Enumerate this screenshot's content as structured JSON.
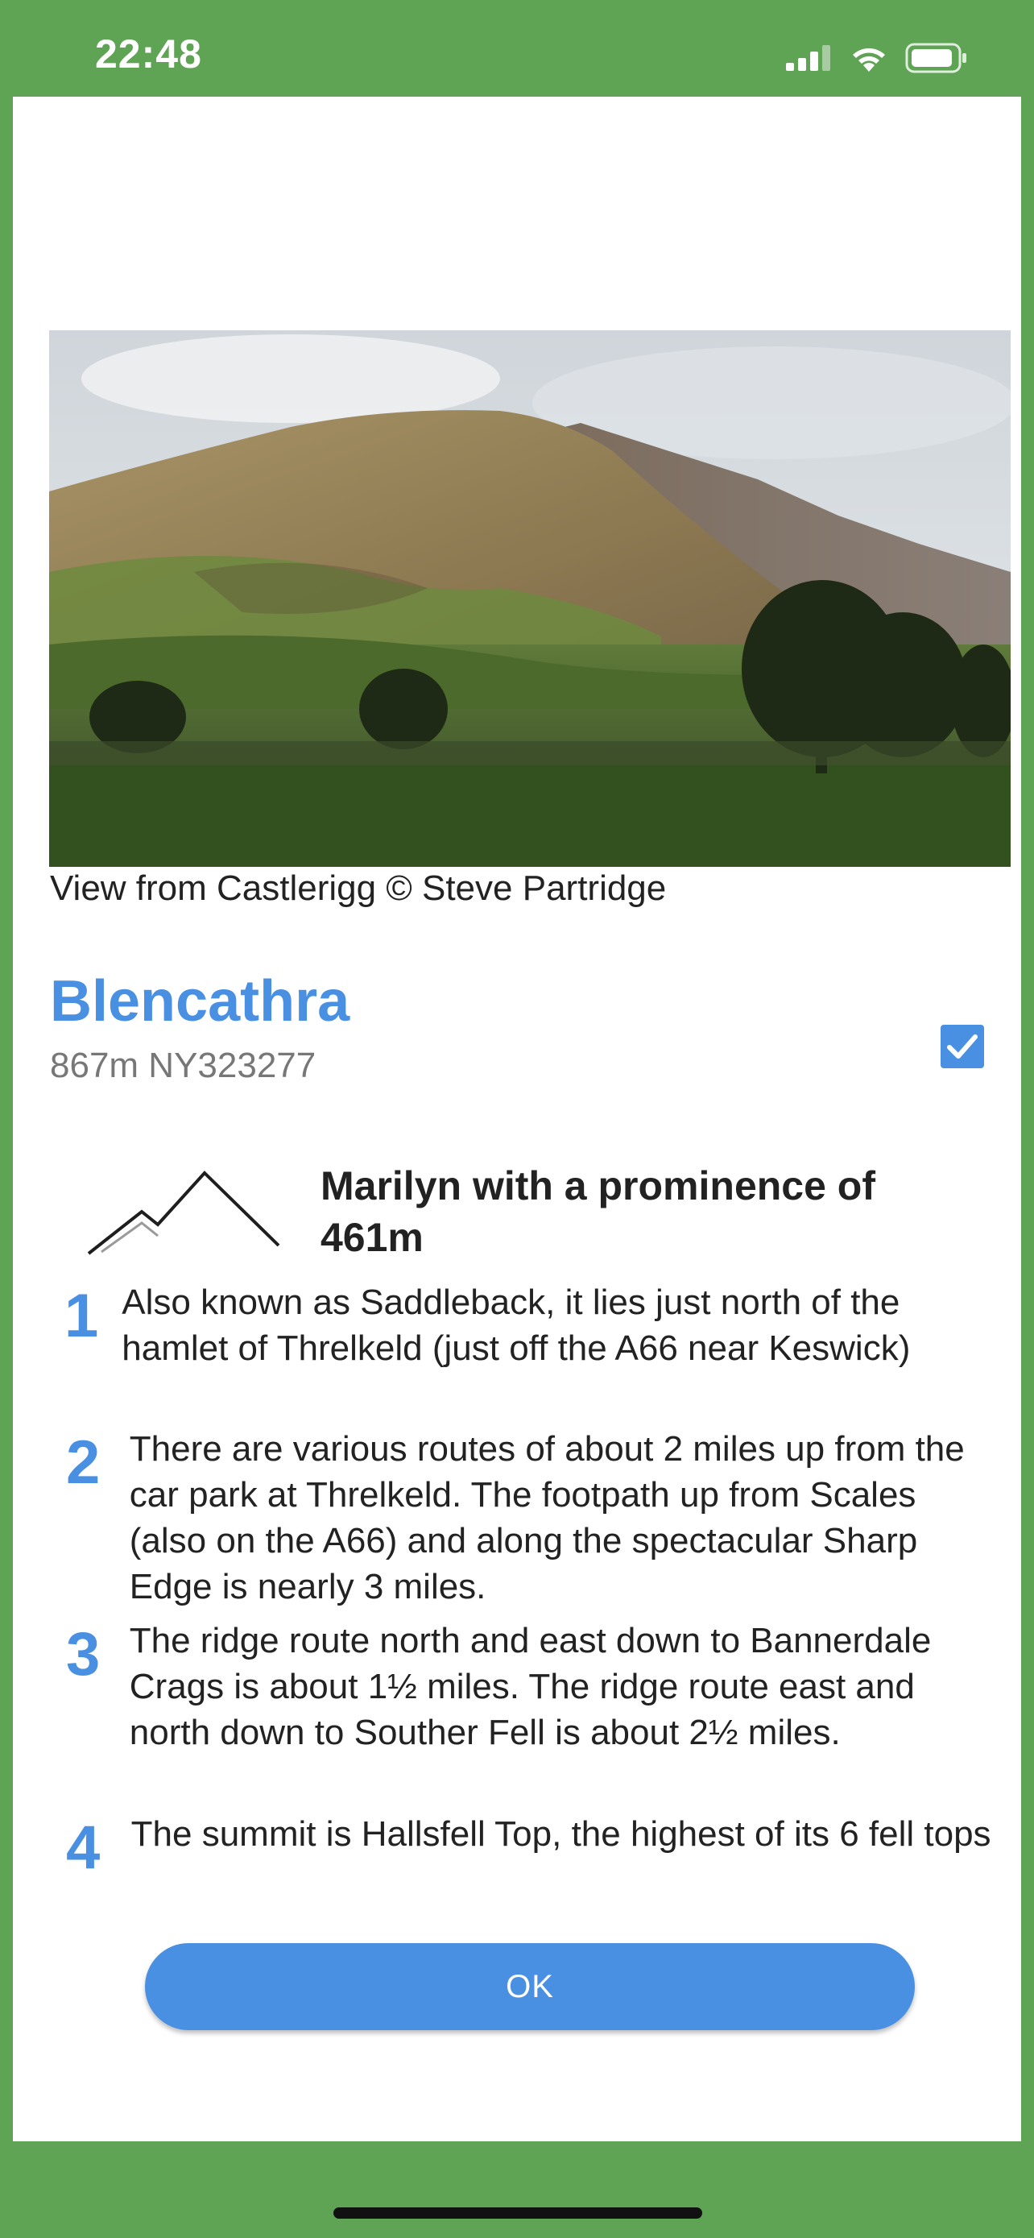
{
  "status_bar": {
    "time": "22:48",
    "icons": [
      "cellular-signal-icon",
      "wifi-icon",
      "battery-icon"
    ]
  },
  "photo": {
    "caption": "View from Castlerigg © Steve Partridge"
  },
  "hill": {
    "name": "Blencathra",
    "details": "867m NY323277",
    "climbed_checkbox": {
      "checked": true
    }
  },
  "classification": {
    "text": "Marilyn with a prominence of 461m",
    "icon": "mountain-icon"
  },
  "facts": [
    {
      "number": "1",
      "text": "Also known as Saddleback, it lies just north of the hamlet of Threlkeld (just off the A66 near Keswick)"
    },
    {
      "number": "2",
      "text": "There are various routes of about 2 miles up from the car park at Threlkeld. The footpath up from Scales (also on the A66) and along the spectacular Sharp Edge is nearly 3 miles."
    },
    {
      "number": "3",
      "text": "The ridge route north and east down to Bannerdale Crags is about 1½ miles. The ridge route east and north down to Souther Fell is about 2½ miles."
    },
    {
      "number": "4",
      "text": "The summit is Hallsfell Top, the highest of its 6 fell tops"
    }
  ],
  "ok_button": {
    "label": "OK"
  },
  "colors": {
    "background_green": "#5fa355",
    "accent_blue": "#4a90e2",
    "sheet": "#ffffff"
  }
}
